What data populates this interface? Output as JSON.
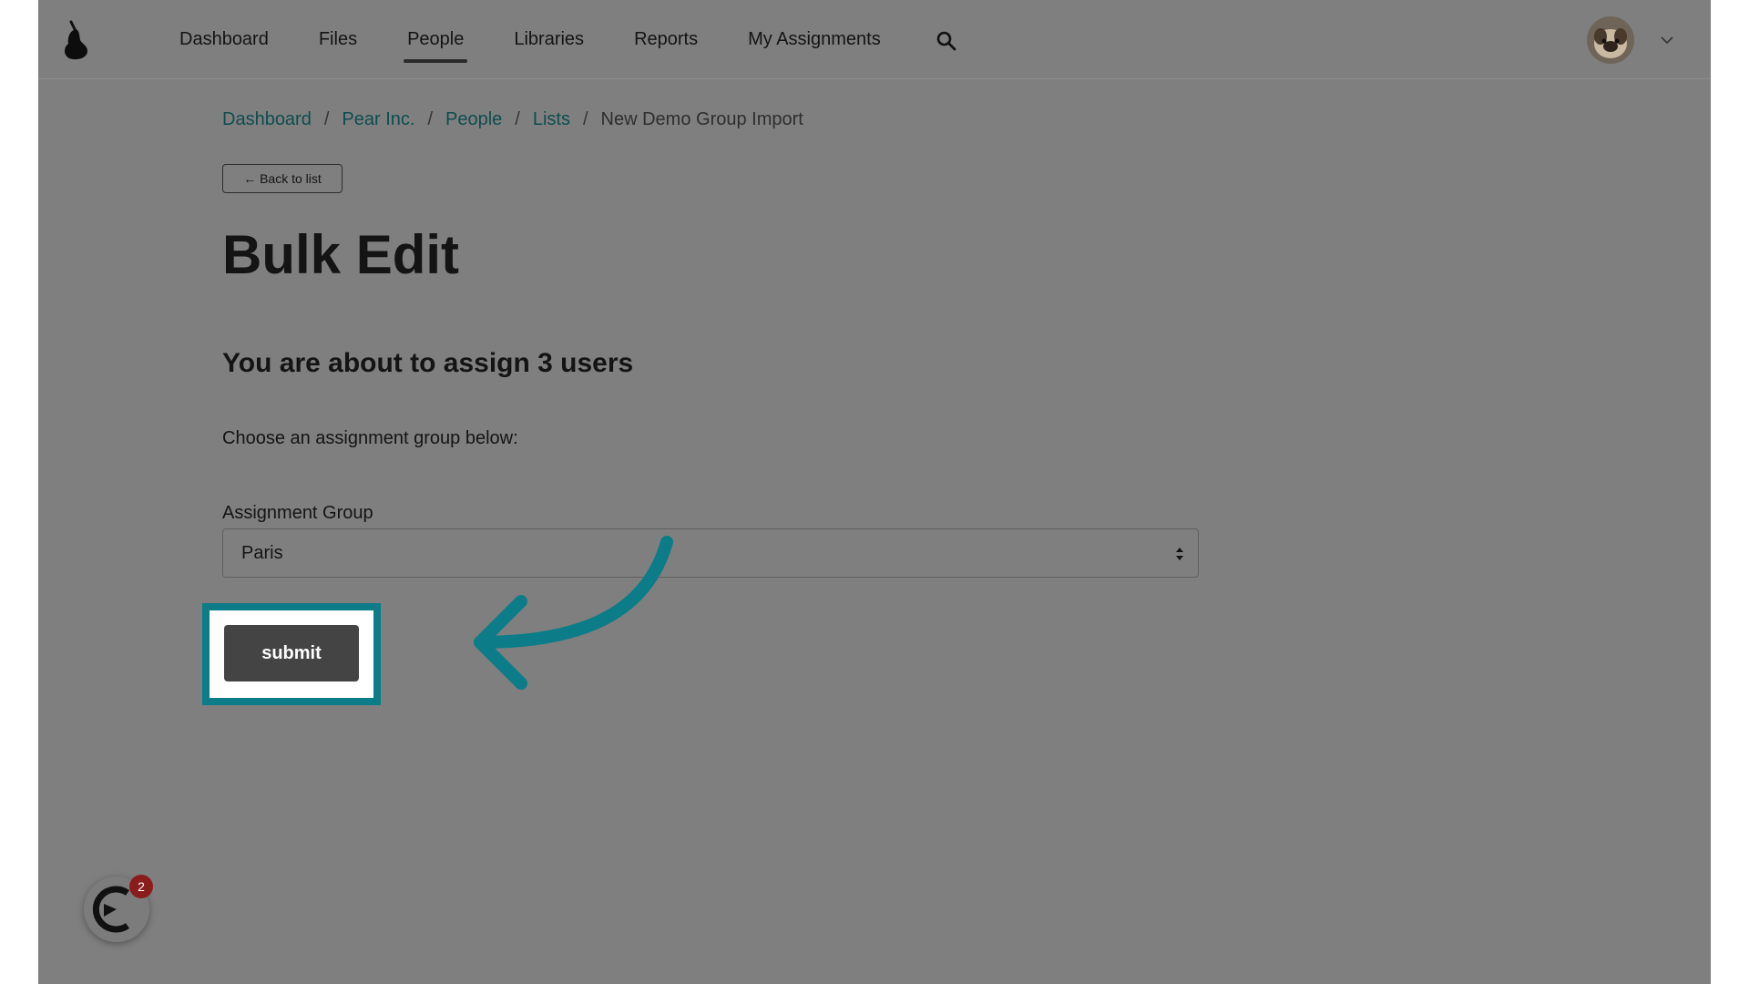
{
  "nav": {
    "items": [
      {
        "label": "Dashboard",
        "active": false
      },
      {
        "label": "Files",
        "active": false
      },
      {
        "label": "People",
        "active": true
      },
      {
        "label": "Libraries",
        "active": false
      },
      {
        "label": "Reports",
        "active": false
      },
      {
        "label": "My Assignments",
        "active": false
      }
    ],
    "search_icon": "search-icon",
    "avatar_icon": "user-avatar",
    "menu_icon": "chevron-down-icon"
  },
  "breadcrumb": {
    "items": [
      "Dashboard",
      "Pear Inc.",
      "People",
      "Lists"
    ],
    "separator": "/",
    "current": "New Demo Group Import"
  },
  "back_button": {
    "label": "← Back to list"
  },
  "page": {
    "title": "Bulk Edit",
    "subtitle": "You are about to assign 3 users",
    "instruction": "Choose an assignment group below:"
  },
  "form": {
    "field_label": "Assignment Group",
    "selected_value": "Paris",
    "submit_label": "submit"
  },
  "widget": {
    "badge_count": "2"
  },
  "colors": {
    "overlay": "#7f7f7f",
    "highlight": "#0b7c88",
    "link": "#0e4d4f",
    "submit_bg": "#444444",
    "badge": "#8b1c1c"
  }
}
